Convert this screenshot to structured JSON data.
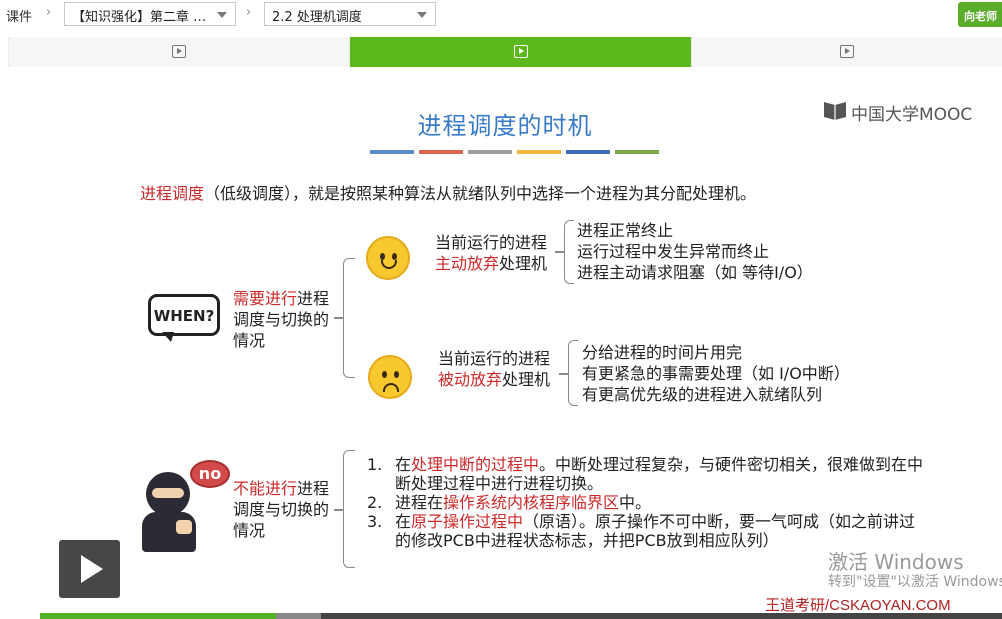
{
  "nav": {
    "root": "课件",
    "chapter_select": "【知识强化】第二章 …",
    "section_select": "2.2 处理机调度",
    "teacher_button": "向老师"
  },
  "progress": {
    "played_fraction": 0.245,
    "buffered_fraction": 0.292
  },
  "slide": {
    "logo_text": "中国大学MOOC",
    "title": "进程调度的时机",
    "color_bars": [
      "#5b8bc9",
      "#d9664d",
      "#9e9e9e",
      "#efb73a",
      "#3f6fb0",
      "#78aa4e"
    ],
    "intro_red": "进程调度",
    "intro_rest": "（低级调度），就是按照某种算法从就绪队列中选择一个进程为其分配处理机。",
    "when_badge": "WHEN?",
    "need": {
      "label_red": "需要进行",
      "label_rest": "进程调度与切换的情况",
      "active": {
        "pre": "当前运行的进程",
        "red": "主动放弃",
        "post": "处理机",
        "items": [
          "进程正常终止",
          "运行过程中发生异常而终止",
          "进程主动请求阻塞（如 等待I/O）"
        ]
      },
      "passive": {
        "pre": "当前运行的进程",
        "red": "被动放弃",
        "post": "处理机",
        "items": [
          "分给进程的时间片用完",
          "有更紧急的事需要处理（如 I/O中断）",
          "有更高优先级的进程进入就绪队列"
        ]
      }
    },
    "no_badge": "no",
    "cannot": {
      "label_red": "不能进行",
      "label_rest": "进程调度与切换的情况",
      "items": [
        {
          "num": "1.",
          "pre": "在",
          "red": "处理中断的过程中",
          "post": "。中断处理过程复杂，与硬件密切相关，很难做到在中断处理过程中进行进程切换。"
        },
        {
          "num": "2.",
          "pre": "进程在",
          "red": "操作系统内核程序临界区",
          "post": "中。"
        },
        {
          "num": "3.",
          "pre": "在",
          "red": "原子操作过程中",
          "post": "（原语）。原子操作不可中断，要一气呵成（如之前讲过的修改PCB中进程状态标志，并把PCB放到相应队列）"
        }
      ]
    },
    "watermark_line1": "激活 Windows",
    "watermark_line2": "转到\"设置\"以激活 Windows",
    "brand": "王道考研/CSKAOYAN.COM"
  }
}
